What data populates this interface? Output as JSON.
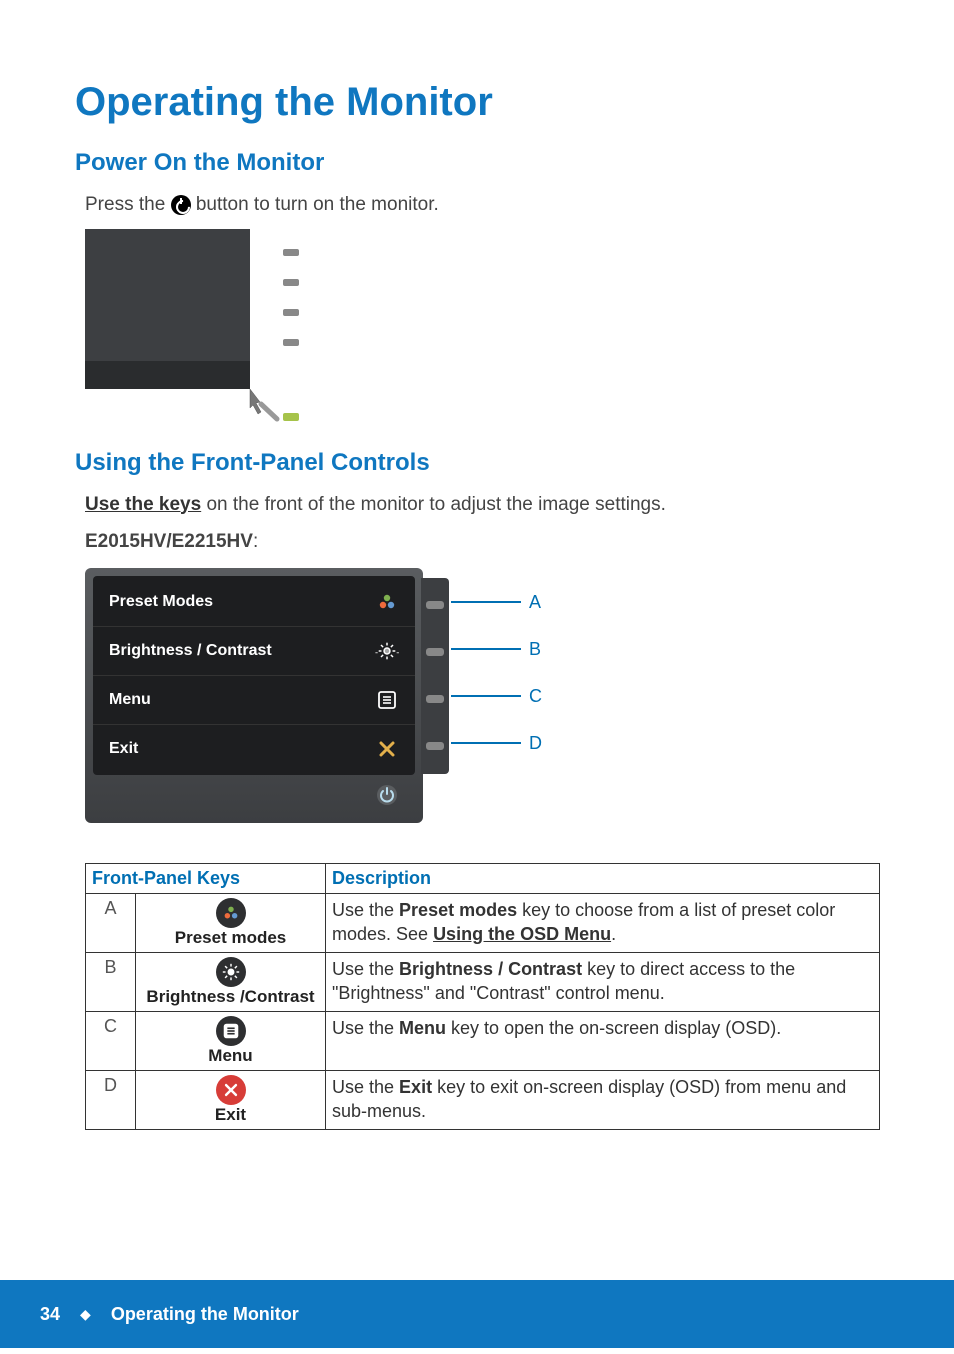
{
  "page_title": "Operating the Monitor",
  "section1": {
    "heading": "Power On the Monitor",
    "text_before": "Press the ",
    "text_after": " button to turn on the monitor."
  },
  "section2": {
    "heading": "Using the Front-Panel Controls",
    "link_text": "Use the keys",
    "text_after": " on the front of the monitor to adjust the image settings.",
    "model_line": "E2015HV/E2215HV",
    "colon": ":"
  },
  "osd": {
    "rows": [
      {
        "label": "Preset Modes",
        "icon": "preset-modes-icon",
        "callout": "A"
      },
      {
        "label": "Brightness / Contrast",
        "icon": "brightness-icon",
        "callout": "B"
      },
      {
        "label": "Menu",
        "icon": "menu-icon",
        "callout": "C"
      },
      {
        "label": "Exit",
        "icon": "exit-x-icon",
        "callout": "D"
      }
    ]
  },
  "table": {
    "head": {
      "col1": "Front-Panel Keys",
      "col2": "Description"
    },
    "link_osd": "Using the OSD Menu",
    "rows": [
      {
        "letter": "A",
        "key_name": "Preset modes",
        "icon": "preset-modes-icon",
        "badge": "dark",
        "desc_pre": "Use the ",
        "desc_bold": "Preset modes",
        "desc_mid": " key to choose from a list of preset color modes. See ",
        "desc_link": "Using the OSD Menu",
        "desc_post": "."
      },
      {
        "letter": "B",
        "key_name": "Brightness /Contrast",
        "icon": "brightness-icon",
        "badge": "dark",
        "desc_pre": "Use the ",
        "desc_bold": "Brightness / Contrast",
        "desc_mid": " key to direct access to the \"Brightness\" and \"Contrast\" control menu.",
        "desc_link": "",
        "desc_post": ""
      },
      {
        "letter": "C",
        "key_name": "Menu",
        "icon": "menu-icon",
        "badge": "dark",
        "desc_pre": "Use the ",
        "desc_bold": "Menu",
        "desc_mid": " key to open the on-screen display (OSD).",
        "desc_link": "",
        "desc_post": ""
      },
      {
        "letter": "D",
        "key_name": "Exit",
        "icon": "exit-x-icon",
        "badge": "red",
        "desc_pre": "Use the ",
        "desc_bold": "Exit",
        "desc_mid": " key to exit on-screen display (OSD) from menu and sub-menus.",
        "desc_link": "",
        "desc_post": ""
      }
    ]
  },
  "footer": {
    "page_number": "34",
    "title": "Operating the Monitor"
  }
}
